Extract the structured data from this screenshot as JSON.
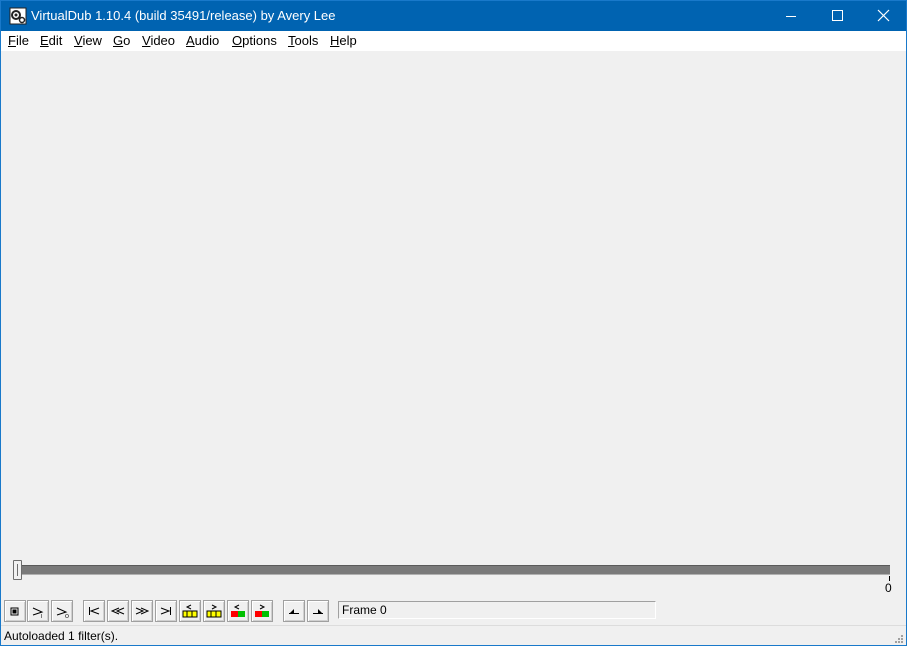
{
  "window": {
    "title": "VirtualDub 1.10.4 (build 35491/release) by Avery Lee",
    "titlebar_color": "#0063b1"
  },
  "menu": [
    {
      "label": "File"
    },
    {
      "label": "Edit"
    },
    {
      "label": "View"
    },
    {
      "label": "Go"
    },
    {
      "label": "Video"
    },
    {
      "label": "Audio"
    },
    {
      "label": "Options"
    },
    {
      "label": "Tools"
    },
    {
      "label": "Help"
    }
  ],
  "timeline": {
    "position_label": "0",
    "position_fraction": 0
  },
  "toolbar": {
    "buttons": [
      "stop-icon",
      "play-input-icon",
      "play-output-icon",
      "go-start-icon",
      "previous-frame-icon",
      "next-frame-icon",
      "go-end-icon",
      "previous-keyframe-icon",
      "next-keyframe-icon",
      "previous-scene-icon",
      "next-scene-icon",
      "mark-in-icon",
      "mark-out-icon"
    ],
    "frame_text": "Frame 0"
  },
  "status": {
    "text": "Autoloaded 1 filter(s)."
  }
}
